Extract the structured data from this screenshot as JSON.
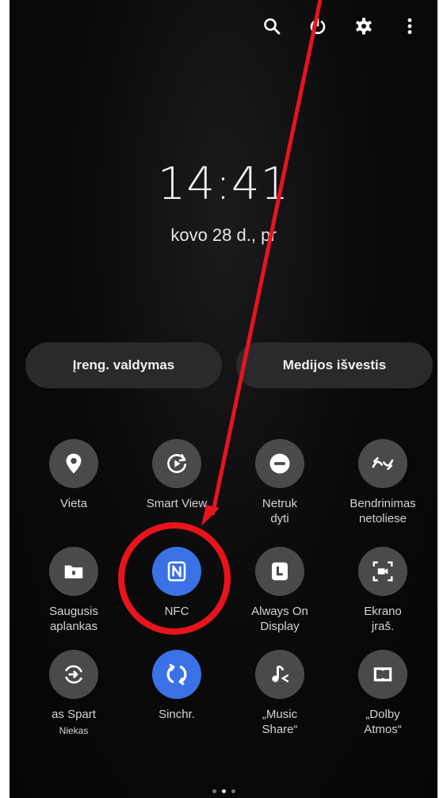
{
  "top_bar": {
    "icons": [
      "search-icon",
      "power-icon",
      "gear-icon",
      "more-vertical-icon"
    ]
  },
  "lockscreen": {
    "time": "14:41",
    "date": "kovo 28 d., pr"
  },
  "buttons": {
    "device_control": "Įreng. valdymas",
    "media_output": "Medijos išvestis"
  },
  "tiles": [
    {
      "label": "Vieta",
      "icon": "location-pin-icon",
      "active": false
    },
    {
      "label": "Smart View",
      "icon": "smart-view-icon",
      "active": false
    },
    {
      "label": "Netruk\ndyti",
      "icon": "do-not-disturb-icon",
      "active": false
    },
    {
      "label": "Bendrinimas\nnetoliese",
      "icon": "nearby-share-icon",
      "active": false
    },
    {
      "label": "Saugusis\naplankas",
      "icon": "secure-folder-icon",
      "active": false
    },
    {
      "label": "NFC",
      "icon": "nfc-icon",
      "active": true
    },
    {
      "label": "Always On\nDisplay",
      "icon": "always-on-display-icon",
      "active": false
    },
    {
      "label": "Ekrano\njraš.",
      "icon": "screen-record-icon",
      "active": false
    },
    {
      "label": "as    Spart",
      "sublabel": "Niekas",
      "icon": "quick-share-icon",
      "active": false
    },
    {
      "label": "Sinchr.",
      "icon": "sync-icon",
      "active": true
    },
    {
      "label": "„Music\nShare“",
      "icon": "music-share-icon",
      "active": false
    },
    {
      "label": "„Dolby\nAtmos“",
      "icon": "dolby-atmos-icon",
      "active": false
    }
  ],
  "pager": {
    "pages": 3,
    "active": 1
  },
  "colors": {
    "accent": "#3a72e6",
    "tile": "#4a4a4c",
    "annotation": "#e8141c"
  }
}
